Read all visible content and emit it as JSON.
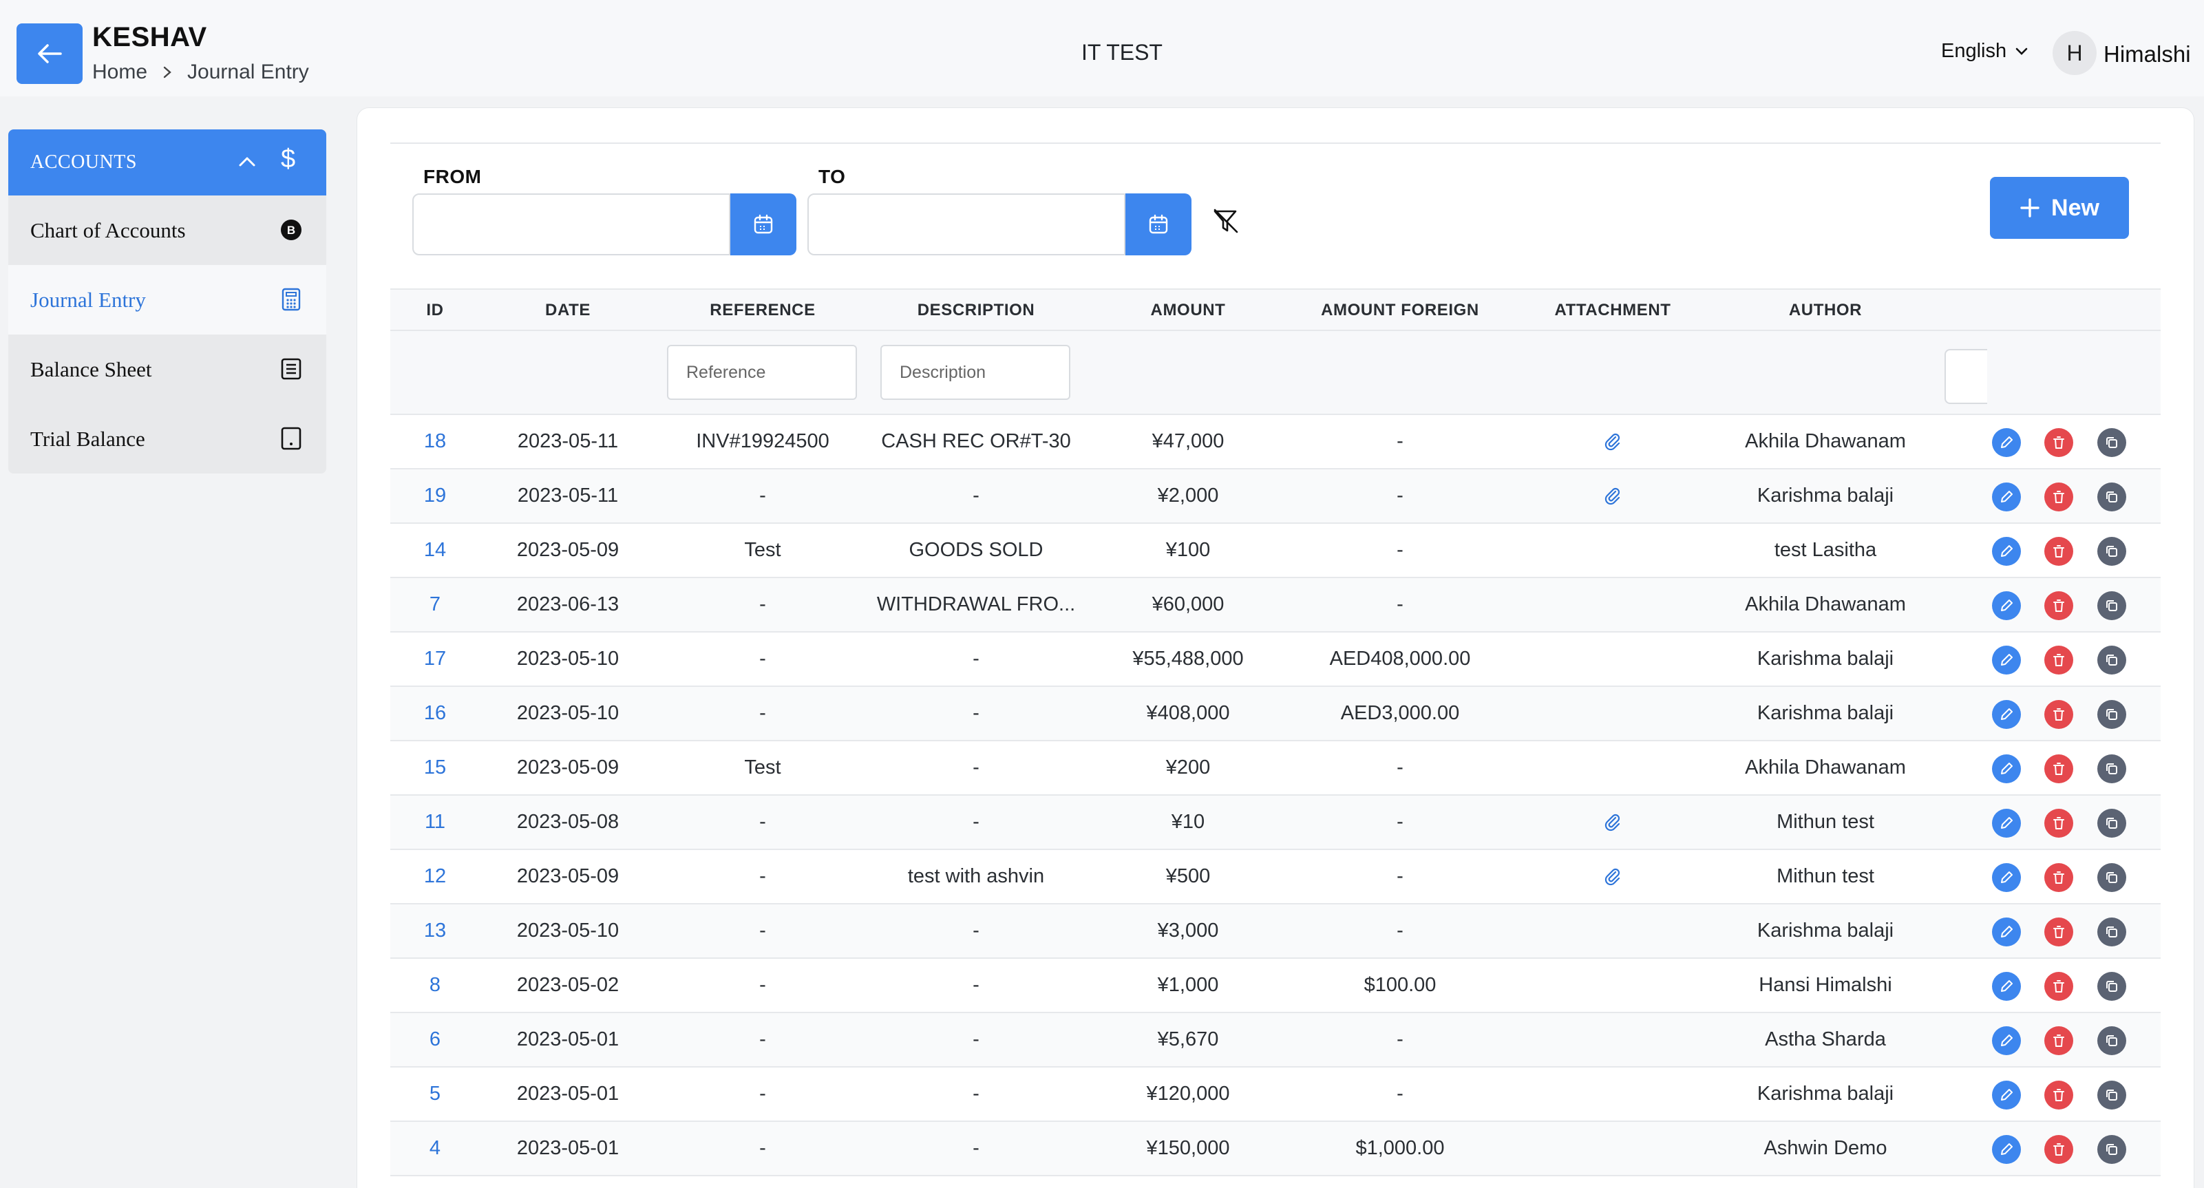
{
  "header": {
    "app_name": "KESHAV",
    "breadcrumb": [
      "Home",
      "Journal Entry"
    ],
    "center_title": "IT TEST",
    "language": "English",
    "user_initial": "H",
    "user_name": "Himalshi"
  },
  "sidebar": {
    "section_label": "ACCOUNTS",
    "section_icon": "$",
    "items": [
      {
        "label": "Chart of Accounts",
        "icon": "bitcoin-icon",
        "active": false
      },
      {
        "label": "Journal Entry",
        "icon": "calculator-icon",
        "active": true
      },
      {
        "label": "Balance Sheet",
        "icon": "list-document-icon",
        "active": false
      },
      {
        "label": "Trial Balance",
        "icon": "tablet-icon",
        "active": false
      }
    ]
  },
  "filters": {
    "from_label": "FROM",
    "to_label": "TO",
    "from_value": "",
    "to_value": "",
    "new_label": "New"
  },
  "table": {
    "columns": [
      "ID",
      "DATE",
      "REFERENCE",
      "DESCRIPTION",
      "AMOUNT",
      "AMOUNT FOREIGN",
      "ATTACHMENT",
      "AUTHOR"
    ],
    "reference_placeholder": "Reference",
    "description_placeholder": "Description",
    "rows": [
      {
        "id": "18",
        "date": "2023-05-11",
        "reference": "INV#19924500",
        "description": "CASH REC OR#T-30",
        "amount": "¥47,000",
        "amount_foreign": "-",
        "attachment": true,
        "author": "Akhila Dhawanam"
      },
      {
        "id": "19",
        "date": "2023-05-11",
        "reference": "-",
        "description": "-",
        "amount": "¥2,000",
        "amount_foreign": "-",
        "attachment": true,
        "author": "Karishma balaji"
      },
      {
        "id": "14",
        "date": "2023-05-09",
        "reference": "Test",
        "description": "GOODS SOLD",
        "amount": "¥100",
        "amount_foreign": "-",
        "attachment": false,
        "author": "test Lasitha"
      },
      {
        "id": "7",
        "date": "2023-06-13",
        "reference": "-",
        "description": "WITHDRAWAL FRO...",
        "amount": "¥60,000",
        "amount_foreign": "-",
        "attachment": false,
        "author": "Akhila Dhawanam"
      },
      {
        "id": "17",
        "date": "2023-05-10",
        "reference": "-",
        "description": "-",
        "amount": "¥55,488,000",
        "amount_foreign": "AED408,000.00",
        "attachment": false,
        "author": "Karishma balaji"
      },
      {
        "id": "16",
        "date": "2023-05-10",
        "reference": "-",
        "description": "-",
        "amount": "¥408,000",
        "amount_foreign": "AED3,000.00",
        "attachment": false,
        "author": "Karishma balaji"
      },
      {
        "id": "15",
        "date": "2023-05-09",
        "reference": "Test",
        "description": "-",
        "amount": "¥200",
        "amount_foreign": "-",
        "attachment": false,
        "author": "Akhila Dhawanam"
      },
      {
        "id": "11",
        "date": "2023-05-08",
        "reference": "-",
        "description": "-",
        "amount": "¥10",
        "amount_foreign": "-",
        "attachment": true,
        "author": "Mithun test"
      },
      {
        "id": "12",
        "date": "2023-05-09",
        "reference": "-",
        "description": "test with ashvin",
        "amount": "¥500",
        "amount_foreign": "-",
        "attachment": true,
        "author": "Mithun test"
      },
      {
        "id": "13",
        "date": "2023-05-10",
        "reference": "-",
        "description": "-",
        "amount": "¥3,000",
        "amount_foreign": "-",
        "attachment": false,
        "author": "Karishma balaji"
      },
      {
        "id": "8",
        "date": "2023-05-02",
        "reference": "-",
        "description": "-",
        "amount": "¥1,000",
        "amount_foreign": "$100.00",
        "attachment": false,
        "author": "Hansi Himalshi"
      },
      {
        "id": "6",
        "date": "2023-05-01",
        "reference": "-",
        "description": "-",
        "amount": "¥5,670",
        "amount_foreign": "-",
        "attachment": false,
        "author": "Astha Sharda"
      },
      {
        "id": "5",
        "date": "2023-05-01",
        "reference": "-",
        "description": "-",
        "amount": "¥120,000",
        "amount_foreign": "-",
        "attachment": false,
        "author": "Karishma balaji"
      },
      {
        "id": "4",
        "date": "2023-05-01",
        "reference": "-",
        "description": "-",
        "amount": "¥150,000",
        "amount_foreign": "$1,000.00",
        "attachment": false,
        "author": "Ashwin Demo"
      }
    ]
  },
  "colors": {
    "accent": "#3d86ee",
    "danger": "#e5484d",
    "neutral": "#5b6373",
    "link": "#2d74d9"
  }
}
